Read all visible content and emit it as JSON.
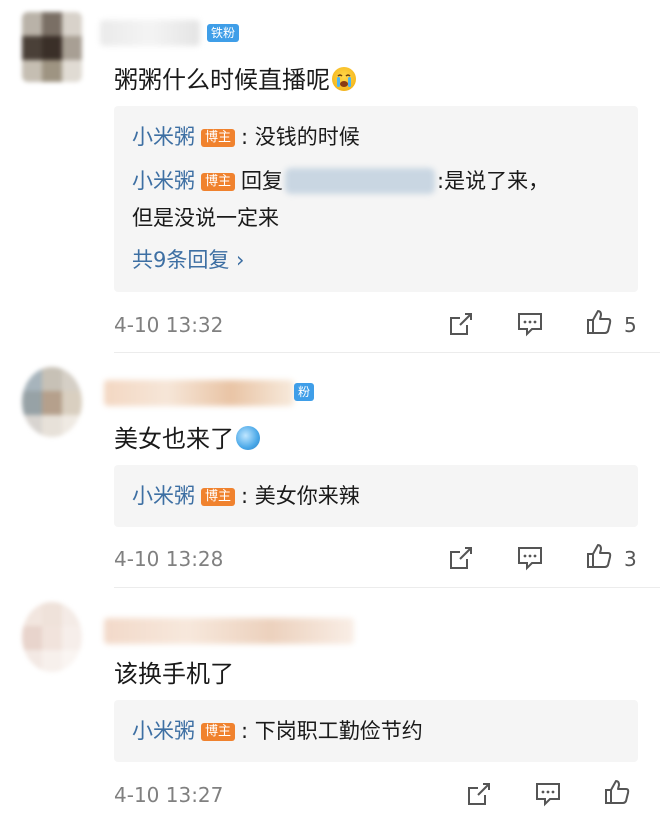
{
  "comments": [
    {
      "fan_badge": "铁粉",
      "text": "粥粥什么时候直播呢",
      "emoji_icon": "crying-emoji-icon",
      "replies": [
        {
          "name": "小米粥",
          "badge": "博主",
          "sep": ":",
          "text": "没钱的时候"
        },
        {
          "name": "小米粥",
          "badge": "博主",
          "prefix": "回复",
          "text": ":是说了来，",
          "text_cont": "但是没说一定来"
        }
      ],
      "more_replies": "共9条回复 ›",
      "time": "4-10 13:32",
      "like_count": "5"
    },
    {
      "fan_badge": "粉",
      "text": "美女也来了",
      "emoji_icon": "globe-emoji-icon",
      "replies": [
        {
          "name": "小米粥",
          "badge": "博主",
          "sep": ":",
          "text": "美女你来辣"
        }
      ],
      "time": "4-10 13:28",
      "like_count": "3"
    },
    {
      "text": "该换手机了",
      "replies": [
        {
          "name": "小米粥",
          "badge": "博主",
          "sep": ":",
          "text": "下岗职工勤俭节约"
        }
      ],
      "time": "4-10 13:27",
      "like_count": ""
    }
  ],
  "colors": {
    "link_blue": "#3d6fa3",
    "badge_orange": "#f0822e",
    "fan_badge_blue": "#3f9ee8",
    "reply_bg": "#f5f5f5",
    "meta_gray": "#808080"
  },
  "icons": [
    "share-icon",
    "comment-icon",
    "like-icon"
  ]
}
